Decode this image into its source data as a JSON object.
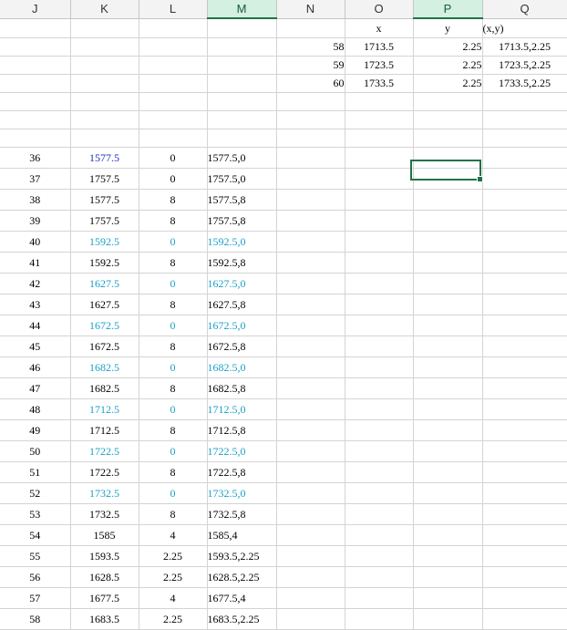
{
  "columns": [
    "J",
    "K",
    "L",
    "M",
    "N",
    "O",
    "P",
    "Q"
  ],
  "selected_column": "M",
  "highlight_column": "P",
  "colors": {
    "highlight_text": "#18a0c8",
    "blue_text": "#1f2fbf",
    "selection": "#217346",
    "header_selected_bg": "#d3f0e0"
  },
  "top_block": [
    {
      "n": "",
      "o": "x",
      "p": "y",
      "q": "(x,y)"
    },
    {
      "n": "58",
      "o": "1713.5",
      "p": "2.25",
      "q": "1713.5,2.25"
    },
    {
      "n": "59",
      "o": "1723.5",
      "p": "2.25",
      "q": "1723.5,2.25"
    },
    {
      "n": "60",
      "o": "1733.5",
      "p": "2.25",
      "q": "1733.5,2.25"
    }
  ],
  "rows": [
    {
      "j": "36",
      "k": "1577.5",
      "l": "0",
      "m": "1577.5,0",
      "style": "blue"
    },
    {
      "j": "37",
      "k": "1757.5",
      "l": "0",
      "m": "1757.5,0",
      "style": ""
    },
    {
      "j": "38",
      "k": "1577.5",
      "l": "8",
      "m": "1577.5,8",
      "style": ""
    },
    {
      "j": "39",
      "k": "1757.5",
      "l": "8",
      "m": "1757.5,8",
      "style": ""
    },
    {
      "j": "40",
      "k": "1592.5",
      "l": "0",
      "m": "1592.5,0",
      "style": "hl"
    },
    {
      "j": "41",
      "k": "1592.5",
      "l": "8",
      "m": "1592.5,8",
      "style": ""
    },
    {
      "j": "42",
      "k": "1627.5",
      "l": "0",
      "m": "1627.5,0",
      "style": "hl"
    },
    {
      "j": "43",
      "k": "1627.5",
      "l": "8",
      "m": "1627.5,8",
      "style": ""
    },
    {
      "j": "44",
      "k": "1672.5",
      "l": "0",
      "m": "1672.5,0",
      "style": "hl"
    },
    {
      "j": "45",
      "k": "1672.5",
      "l": "8",
      "m": "1672.5,8",
      "style": ""
    },
    {
      "j": "46",
      "k": "1682.5",
      "l": "0",
      "m": "1682.5,0",
      "style": "hl"
    },
    {
      "j": "47",
      "k": "1682.5",
      "l": "8",
      "m": "1682.5,8",
      "style": ""
    },
    {
      "j": "48",
      "k": "1712.5",
      "l": "0",
      "m": "1712.5,0",
      "style": "hl"
    },
    {
      "j": "49",
      "k": "1712.5",
      "l": "8",
      "m": "1712.5,8",
      "style": ""
    },
    {
      "j": "50",
      "k": "1722.5",
      "l": "0",
      "m": "1722.5,0",
      "style": "hl"
    },
    {
      "j": "51",
      "k": "1722.5",
      "l": "8",
      "m": "1722.5,8",
      "style": ""
    },
    {
      "j": "52",
      "k": "1732.5",
      "l": "0",
      "m": "1732.5,0",
      "style": "hl"
    },
    {
      "j": "53",
      "k": "1732.5",
      "l": "8",
      "m": "1732.5,8",
      "style": ""
    },
    {
      "j": "54",
      "k": "1585",
      "l": "4",
      "m": "1585,4",
      "style": ""
    },
    {
      "j": "55",
      "k": "1593.5",
      "l": "2.25",
      "m": "1593.5,2.25",
      "style": ""
    },
    {
      "j": "56",
      "k": "1628.5",
      "l": "2.25",
      "m": "1628.5,2.25",
      "style": ""
    },
    {
      "j": "57",
      "k": "1677.5",
      "l": "4",
      "m": "1677.5,4",
      "style": ""
    },
    {
      "j": "58",
      "k": "1683.5",
      "l": "2.25",
      "m": "1683.5,2.25",
      "style": ""
    }
  ]
}
